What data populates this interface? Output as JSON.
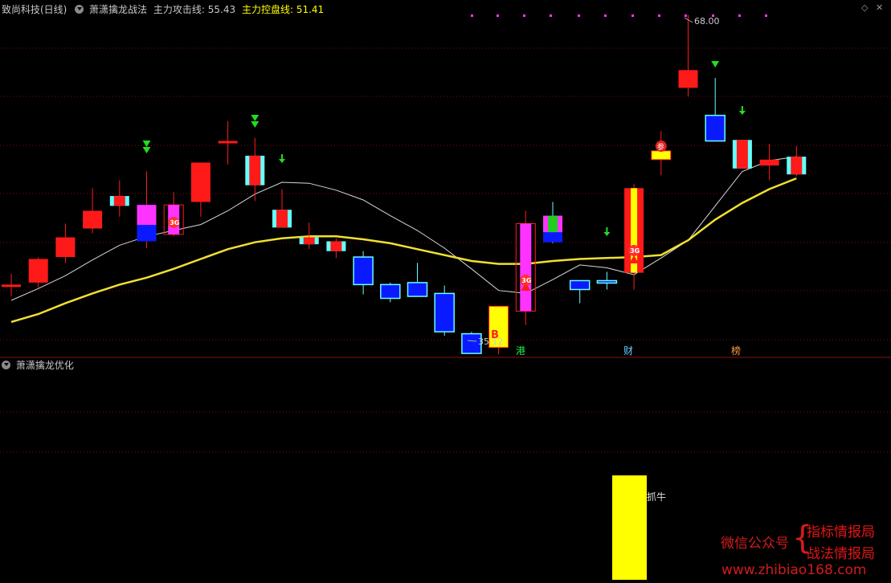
{
  "header": {
    "stock": "致尚科技(日线)",
    "indicator": "萧潇擒龙战法",
    "attack_label": "主力攻击线:",
    "attack_value": "55.43",
    "control_label": "主力控盘线:",
    "control_value": "51.41"
  },
  "sub_panel": {
    "title": "萧潇擒龙优化",
    "signal_label": "抓牛"
  },
  "window_controls": {
    "diamond": "◇",
    "close": "✕"
  },
  "annotations": {
    "high": "68.00",
    "low": "35.12",
    "buy": "B",
    "tag_gang": "港",
    "tag_cai": "财",
    "tag_bang": "榜",
    "tag_can": "参",
    "tag_3g": "3G"
  },
  "watermark": {
    "wechat": "微信公众号",
    "brace": "{",
    "line1": "指标情报局",
    "line2": "战法情报局",
    "url": "www.zhibiao168.com"
  },
  "colors": {
    "up": "#ff1a1a",
    "down": "#0a1aff",
    "cyan": "#66ffff",
    "magenta": "#ff33ff",
    "yellow": "#ffff00",
    "green": "#22cc22"
  },
  "chart_data": {
    "type": "candlestick",
    "price_range": [
      35.12,
      68.0
    ],
    "candles": [
      {
        "o": 40.6,
        "h": 41.7,
        "l": 39.4,
        "c": 40.5,
        "fill": "red"
      },
      {
        "o": 40.8,
        "h": 43.4,
        "l": 40.3,
        "c": 43.2,
        "fill": "red"
      },
      {
        "o": 43.4,
        "h": 46.8,
        "l": 42.8,
        "c": 45.4,
        "fill": "red"
      },
      {
        "o": 46.3,
        "h": 50.4,
        "l": 45.8,
        "c": 48.1,
        "fill": "red"
      },
      {
        "o": 49.6,
        "h": 51.2,
        "l": 47.5,
        "c": 48.6,
        "fill": "cyan-red"
      },
      {
        "o": 48.7,
        "h": 52.1,
        "l": 44.3,
        "c": 45.0,
        "fill": "magenta-blue"
      },
      {
        "o": 48.7,
        "h": 50.0,
        "l": 45.5,
        "c": 45.7,
        "fill": "magenta-outline"
      },
      {
        "o": 49.0,
        "h": 53.0,
        "l": 47.5,
        "c": 53.0,
        "fill": "red"
      },
      {
        "o": 55.2,
        "h": 57.2,
        "l": 52.8,
        "c": 55.0,
        "fill": "red"
      },
      {
        "o": 50.7,
        "h": 55.5,
        "l": 49.1,
        "c": 53.7,
        "fill": "cyan-red"
      },
      {
        "o": 48.2,
        "h": 50.3,
        "l": 46.4,
        "c": 46.4,
        "fill": "cyan-red"
      },
      {
        "o": 45.4,
        "h": 46.9,
        "l": 44.2,
        "c": 44.7,
        "fill": "cyan-red"
      },
      {
        "o": 45.0,
        "h": 45.3,
        "l": 43.3,
        "c": 44.0,
        "fill": "cyan-red"
      },
      {
        "o": 43.4,
        "h": 44.0,
        "l": 39.6,
        "c": 40.6,
        "fill": "blue"
      },
      {
        "o": 40.6,
        "h": 40.8,
        "l": 38.8,
        "c": 39.2,
        "fill": "blue"
      },
      {
        "o": 40.8,
        "h": 42.8,
        "l": 39.4,
        "c": 39.4,
        "fill": "blue"
      },
      {
        "o": 39.7,
        "h": 40.5,
        "l": 35.4,
        "c": 35.8,
        "fill": "blue"
      },
      {
        "o": 35.6,
        "h": 35.8,
        "l": 33.6,
        "c": 33.6,
        "fill": "blue"
      },
      {
        "o": 38.4,
        "h": 38.4,
        "l": 33.5,
        "c": 34.2,
        "fill": "yellow"
      },
      {
        "o": 46.8,
        "h": 48.1,
        "l": 36.5,
        "c": 37.9,
        "fill": "magenta-outline"
      },
      {
        "o": 47.6,
        "h": 49.0,
        "l": 44.8,
        "c": 44.9,
        "fill": "green-blue"
      },
      {
        "o": 41.0,
        "h": 41.0,
        "l": 38.7,
        "c": 40.1,
        "fill": "blue"
      },
      {
        "o": 41.0,
        "h": 41.9,
        "l": 40.1,
        "c": 40.8,
        "fill": "blue"
      },
      {
        "o": 41.8,
        "h": 50.8,
        "l": 40.1,
        "c": 50.4,
        "fill": "red-yellow"
      },
      {
        "o": 54.2,
        "h": 56.2,
        "l": 51.7,
        "c": 53.3,
        "fill": "yellow"
      },
      {
        "o": 62.4,
        "h": 68.0,
        "l": 59.7,
        "c": 60.6,
        "fill": "red"
      },
      {
        "o": 57.8,
        "h": 61.6,
        "l": 55.2,
        "c": 55.2,
        "fill": "blue"
      },
      {
        "o": 55.3,
        "h": 55.3,
        "l": 52.4,
        "c": 52.4,
        "fill": "cyan-red"
      },
      {
        "o": 53.3,
        "h": 54.9,
        "l": 51.2,
        "c": 52.7,
        "fill": "red"
      },
      {
        "o": 53.6,
        "h": 54.7,
        "l": 51.6,
        "c": 51.8,
        "fill": "cyan-red"
      }
    ],
    "attack_line": [
      39.0,
      40.2,
      41.5,
      43.1,
      44.6,
      45.5,
      46.1,
      46.7,
      48.1,
      49.8,
      51.0,
      50.9,
      50.2,
      49.2,
      47.6,
      46.1,
      44.3,
      42.2,
      40.0,
      39.7,
      41.1,
      42.6,
      42.3,
      41.6,
      43.3,
      45.1,
      48.6,
      52.1,
      53.2,
      53.6
    ],
    "control_line": [
      36.8,
      37.6,
      38.7,
      39.7,
      40.6,
      41.3,
      42.2,
      43.2,
      44.2,
      44.9,
      45.3,
      45.5,
      45.5,
      45.2,
      44.8,
      44.2,
      43.6,
      43.0,
      42.7,
      42.7,
      43.0,
      43.2,
      43.3,
      43.4,
      43.6,
      45.1,
      47.2,
      48.9,
      50.3,
      51.4
    ]
  }
}
